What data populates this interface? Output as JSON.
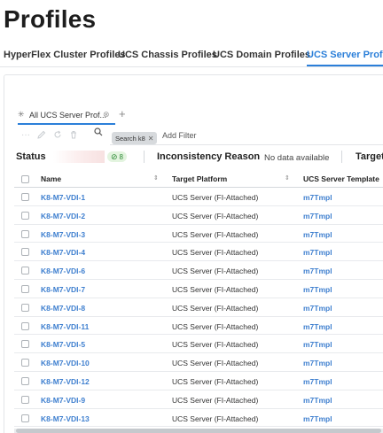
{
  "page": {
    "title": "Profiles"
  },
  "tabs": [
    {
      "label": "HyperFlex Cluster Profiles",
      "active": false
    },
    {
      "label": "UCS Chassis Profiles",
      "active": false
    },
    {
      "label": "UCS Domain Profiles",
      "active": false
    },
    {
      "label": "UCS Server Profiles",
      "active": true
    }
  ],
  "view": {
    "label": "All UCS Server Prof...",
    "add": "+"
  },
  "toolbar": {
    "icons": [
      "more-icon",
      "edit-icon",
      "refresh-icon",
      "delete-icon"
    ]
  },
  "filter": {
    "chip": "Search k8",
    "add_filter": "Add Filter"
  },
  "summary": {
    "status_label": "Status",
    "ok_count": "8",
    "inconsistency_label": "Inconsistency Reason",
    "inconsistency_value": "No data available",
    "target_label": "Target"
  },
  "table": {
    "headers": {
      "name": "Name",
      "platform": "Target Platform",
      "template": "UCS Server Template"
    },
    "rows": [
      {
        "name": "K8-M7-VDI-1",
        "platform": "UCS Server (FI-Attached)",
        "template": "m7Tmpl"
      },
      {
        "name": "K8-M7-VDI-2",
        "platform": "UCS Server (FI-Attached)",
        "template": "m7Tmpl"
      },
      {
        "name": "K8-M7-VDI-3",
        "platform": "UCS Server (FI-Attached)",
        "template": "m7Tmpl"
      },
      {
        "name": "K8-M7-VDI-4",
        "platform": "UCS Server (FI-Attached)",
        "template": "m7Tmpl"
      },
      {
        "name": "K8-M7-VDI-6",
        "platform": "UCS Server (FI-Attached)",
        "template": "m7Tmpl"
      },
      {
        "name": "K8-M7-VDI-7",
        "platform": "UCS Server (FI-Attached)",
        "template": "m7Tmpl"
      },
      {
        "name": "K8-M7-VDI-8",
        "platform": "UCS Server (FI-Attached)",
        "template": "m7Tmpl"
      },
      {
        "name": "K8-M7-VDI-11",
        "platform": "UCS Server (FI-Attached)",
        "template": "m7Tmpl"
      },
      {
        "name": "K8-M7-VDI-5",
        "platform": "UCS Server (FI-Attached)",
        "template": "m7Tmpl"
      },
      {
        "name": "K8-M7-VDI-10",
        "platform": "UCS Server (FI-Attached)",
        "template": "m7Tmpl"
      },
      {
        "name": "K8-M7-VDI-12",
        "platform": "UCS Server (FI-Attached)",
        "template": "m7Tmpl"
      },
      {
        "name": "K8-M7-VDI-9",
        "platform": "UCS Server (FI-Attached)",
        "template": "m7Tmpl"
      },
      {
        "name": "K8-M7-VDI-13",
        "platform": "UCS Server (FI-Attached)",
        "template": "m7Tmpl"
      }
    ]
  },
  "colors": {
    "accent": "#2b7fd9",
    "link": "#3e7fcf",
    "ok": "#2e8b37"
  }
}
